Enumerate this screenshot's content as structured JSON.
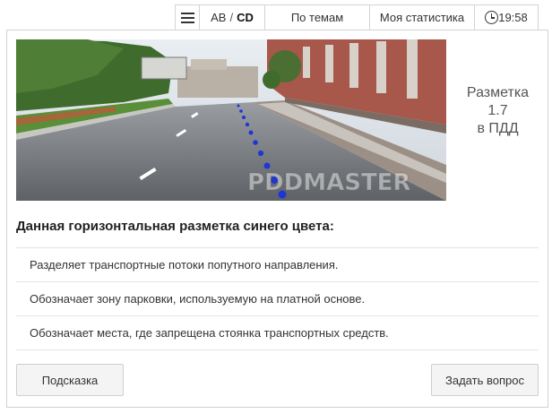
{
  "topbar": {
    "menu_icon": "hamburger-menu-icon",
    "ticket": {
      "ab": "AB",
      "separator": "/",
      "cd": "CD"
    },
    "topics_label": "По темам",
    "stats_label": "Моя статистика",
    "clock_icon": "clock-icon",
    "time": "19:58"
  },
  "question": {
    "image_watermark": "PDDMASTER",
    "caption": {
      "line1": "Разметка",
      "line2": "1.7",
      "line3": "в ПДД"
    },
    "text": "Данная горизонтальная разметка синего цвета:",
    "answers": [
      "Разделяет транспортные потоки попутного направления.",
      "Обозначает зону парковки, используемую на платной основе.",
      "Обозначает места, где запрещена стоянка транспортных средств."
    ]
  },
  "buttons": {
    "hint": "Подсказка",
    "ask": "Задать вопрос"
  },
  "colors": {
    "marking_blue": "#1f35d6",
    "border": "#d3d3d3"
  }
}
